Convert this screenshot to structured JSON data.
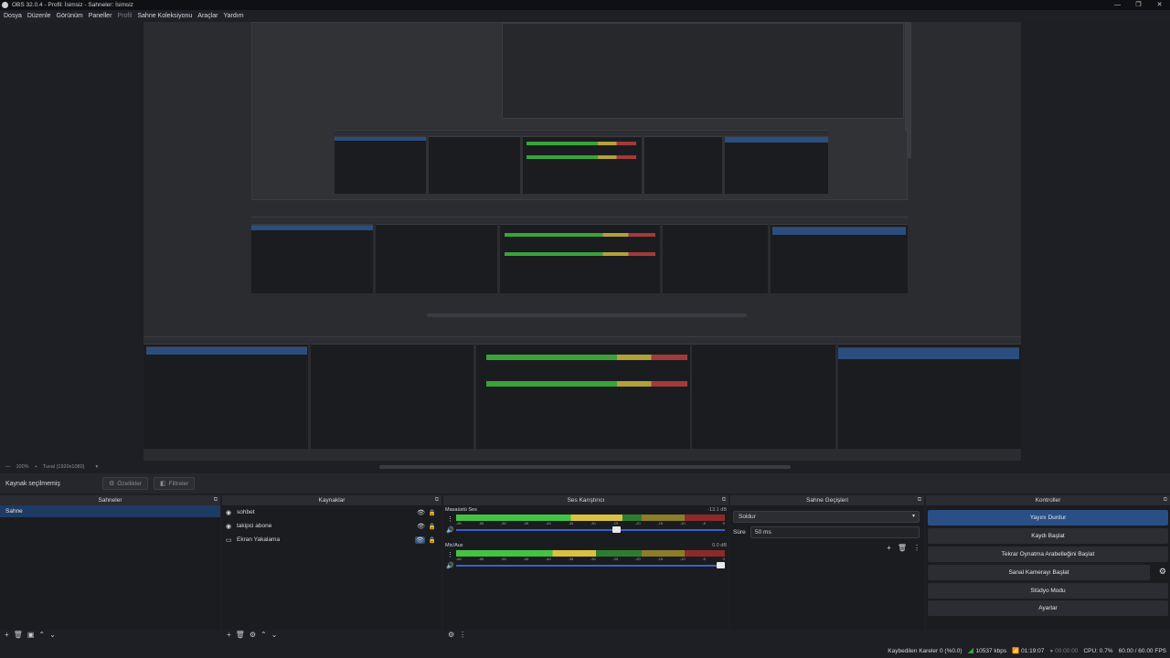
{
  "window": {
    "title": "OBS 32.0.4 - Profil: İsimsiz - Sahneler: İsimsiz",
    "min": "—",
    "max": "❐",
    "close": "✕"
  },
  "menu": [
    "Dosya",
    "Düzenle",
    "Görünüm",
    "Paneller",
    "Profil",
    "Sahne Koleksiyonu",
    "Araçlar",
    "Yardım"
  ],
  "zoom": {
    "minus": "—",
    "level": "100%",
    "plus": "+",
    "canvas": "Tuval (1920x1080)",
    "canvas_dd": "▾"
  },
  "source_toolbar": {
    "no_selection": "Kaynak seçilmemiş",
    "properties": "Özellikler",
    "filters": "Filtreler"
  },
  "docks": {
    "scenes": {
      "title": "Sahneler",
      "items": [
        {
          "label": "Sahne",
          "selected": true
        }
      ],
      "footer": [
        "+",
        "🗑",
        "▣",
        "⌃",
        "⌄"
      ]
    },
    "sources": {
      "title": "Kaynaklar",
      "items": [
        {
          "label": "sohbet",
          "icon": "browser-icon",
          "eye_active": false
        },
        {
          "label": "takipci abone",
          "icon": "browser-icon",
          "eye_active": false
        },
        {
          "label": "Ekran Yakalama",
          "icon": "monitor-icon",
          "eye_active": true
        }
      ],
      "footer": [
        "+",
        "🗑",
        "⚙",
        "⌃",
        "⌄"
      ]
    },
    "mixer": {
      "title": "Ses Karıştırıcı",
      "channels": [
        {
          "name": "Masaüstü Ses",
          "db": "-13.1 dB",
          "level": 0.62,
          "fader": 0.6
        },
        {
          "name": "Mic/Aux",
          "db": "0.0 dB",
          "level": 0.52,
          "fader": 1.0
        }
      ],
      "ticks": [
        "-60",
        "-55",
        "-50",
        "-45",
        "-40",
        "-35",
        "-30",
        "-25",
        "-20",
        "-15",
        "-10",
        "-5",
        "0"
      ],
      "footer": [
        "⚙",
        "⋮"
      ]
    },
    "transitions": {
      "title": "Sahne Geçişleri",
      "selected": "Soldur",
      "duration_label": "Süre",
      "duration_value": "50 ms",
      "buttons": [
        "+",
        "🗑",
        "⋮"
      ]
    },
    "controls": {
      "title": "Kontroller",
      "buttons": [
        {
          "label": "Yayını Durdur",
          "primary": true
        },
        {
          "label": "Kaydı Başlat"
        },
        {
          "label": "Tekrar Oynatma Arabelleğini Başlat"
        },
        {
          "label": "Sanal Kamerayı Başlat",
          "gear": true
        },
        {
          "label": "Stüdyo Modu"
        },
        {
          "label": "Ayarlar"
        }
      ]
    }
  },
  "undock": "⧉",
  "status": {
    "dropped": "Kaybedilen Kareler 0 (%0.0)",
    "bitrate": "10537 kbps",
    "stream_time": "01:19:07",
    "rec_time": "00:00:00",
    "cpu": "CPU: 0.7%",
    "fps": "60.00 / 60.00 FPS"
  },
  "colors": {
    "accent": "#2a4f87",
    "selected_scene": "#1e3b63",
    "meter_green": "#44c244",
    "meter_yellow": "#d9c242",
    "meter_red": "#c24242",
    "fader_blue": "#3a5fc9"
  }
}
